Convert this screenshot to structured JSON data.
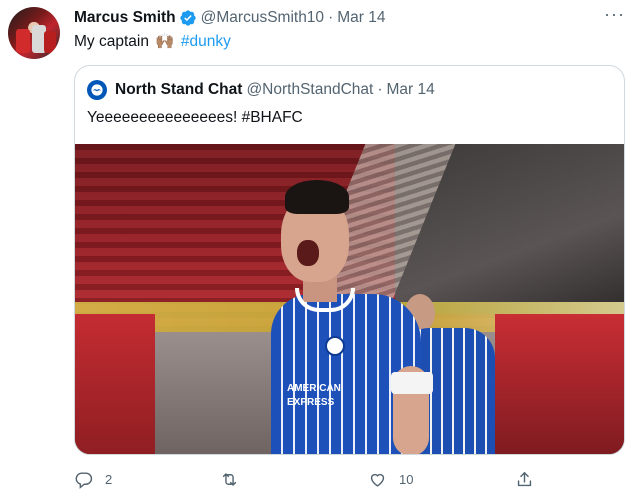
{
  "tweet": {
    "author_name": "Marcus Smith",
    "handle": "@MarcusSmith10",
    "separator": "·",
    "date": "Mar 14",
    "text": "My captain",
    "emoji": "🙌🏽",
    "hashtag": "#dunky"
  },
  "quoted_tweet": {
    "author_name": "North Stand Chat",
    "handle": "@NorthStandChat",
    "separator": "·",
    "date": "Mar 14",
    "text": "Yeeeeeeeeeeeeeees! #BHAFC",
    "image": {
      "sponsor_text": "AMERICAN EXPRESS"
    }
  },
  "actions": {
    "replies": "2",
    "retweets": "",
    "likes": "10"
  },
  "colors": {
    "accent": "#1d9bf0",
    "secondary_text": "#536471",
    "border": "#cfd9de"
  },
  "icons": [
    "verified-badge-icon",
    "more-options-icon",
    "reply-icon",
    "retweet-icon",
    "like-icon",
    "share-icon"
  ]
}
